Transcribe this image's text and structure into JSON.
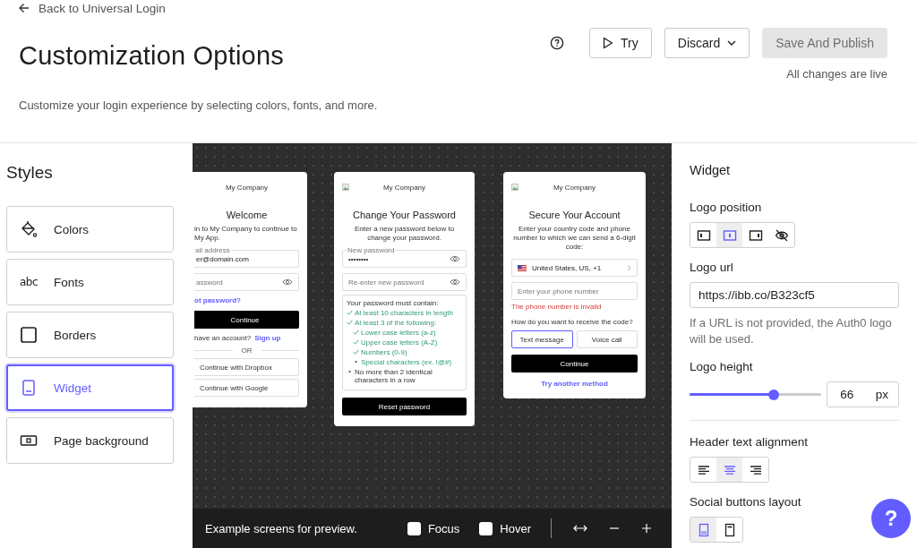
{
  "header": {
    "back_link": "Back to Universal Login",
    "title": "Customization Options",
    "subtitle": "Customize your login experience by selecting colors, fonts, and more.",
    "buttons": [
      {
        "label": "Try",
        "kind": "play",
        "disabled": false
      },
      {
        "label": "Discard",
        "kind": "dropdown",
        "disabled": false
      },
      {
        "label": "Save And Publish",
        "kind": "primary",
        "disabled": true
      }
    ],
    "status": "All changes are live"
  },
  "sidebar": {
    "title": "Styles",
    "items": [
      {
        "label": "Colors",
        "selected": false
      },
      {
        "label": "Fonts",
        "icon_text": "abc",
        "selected": false
      },
      {
        "label": "Borders",
        "selected": false
      },
      {
        "label": "Widget",
        "selected": true
      },
      {
        "label": "Page background",
        "selected": false
      }
    ]
  },
  "preview": {
    "cards": [
      {
        "elements": [
          {
            "kind": "logo",
            "text": "My Company",
            "image": false
          },
          {
            "kind": "title",
            "text": "Welcome"
          },
          {
            "kind": "text",
            "text": "in to My Company to continue to My App."
          },
          {
            "kind": "field",
            "label": "ail address",
            "value": "er@domain.com",
            "eye": false
          },
          {
            "kind": "field",
            "placeholder": "assword",
            "eye": true
          },
          {
            "kind": "forgot_link",
            "text": "ot password?"
          },
          {
            "kind": "button",
            "text": "Continue"
          },
          {
            "kind": "signup",
            "text": "have an account?",
            "link": "Sign up"
          },
          {
            "kind": "separator",
            "text": "OR"
          },
          {
            "kind": "social",
            "text": "Continue with Dropbox"
          },
          {
            "kind": "social",
            "text": "Continue with Google"
          }
        ]
      },
      {
        "elements": [
          {
            "kind": "logo",
            "text": "My Company",
            "image": true
          },
          {
            "kind": "title",
            "text": "Change Your Password"
          },
          {
            "kind": "text",
            "text": "Enter a new password below to change your password."
          },
          {
            "kind": "field",
            "label": "New password",
            "value": "••••••••",
            "eye": true
          },
          {
            "kind": "field",
            "placeholder": "Re-enter new password",
            "eye": true
          },
          {
            "kind": "checklist",
            "heading": "Your password must contain:",
            "items": [
              {
                "text": "At least 10 characters in length",
                "met": true
              },
              {
                "text": "At least 3 of the following:",
                "met": true,
                "children": [
                  {
                    "text": "Lower case letters (a-z)",
                    "met": true
                  },
                  {
                    "text": "Upper case letters (A-Z)",
                    "met": true
                  },
                  {
                    "text": "Numbers (0-9)",
                    "met": true
                  },
                  {
                    "text": "Special characters (ex. !@#)",
                    "met": false
                  }
                ]
              },
              {
                "text": "No more than 2 identical characters in a row",
                "met": false
              }
            ]
          },
          {
            "kind": "button",
            "text": "Reset password"
          }
        ]
      },
      {
        "elements": [
          {
            "kind": "logo",
            "text": "My Company",
            "image": true
          },
          {
            "kind": "title",
            "text": "Secure Your Account"
          },
          {
            "kind": "text",
            "text": "Enter your country code and phone number to which we can send a 6-digit code:"
          },
          {
            "kind": "select",
            "value": "United States, US, +1"
          },
          {
            "kind": "field",
            "placeholder": "Enter your phone number",
            "eye": false
          },
          {
            "kind": "error",
            "text": "The phone number is invalid"
          },
          {
            "kind": "prompt",
            "text": "How do you want to receive the code?"
          },
          {
            "kind": "choices",
            "options": [
              {
                "label": "Text message",
                "selected": true
              },
              {
                "label": "Voice call",
                "selected": false
              }
            ]
          },
          {
            "kind": "button",
            "text": "Continue"
          },
          {
            "kind": "link",
            "text": "Try another method"
          }
        ]
      }
    ],
    "caption": "Example screens for preview.",
    "toggles": [
      {
        "label": "Focus",
        "checked": false
      },
      {
        "label": "Hover",
        "checked": false
      }
    ]
  },
  "panel": {
    "title": "Widget",
    "logo_position": {
      "label": "Logo position",
      "options": [
        {
          "selected": false
        },
        {
          "selected": true
        },
        {
          "selected": false
        },
        {
          "selected": false
        }
      ]
    },
    "logo_url": {
      "label": "Logo url",
      "value": "https://ibb.co/B323cf5",
      "hint": "If a URL is not provided, the Auth0 logo will be used."
    },
    "logo_height": {
      "label": "Logo height",
      "level": 0.64,
      "value": "66",
      "unit": "px"
    },
    "header_alignment": {
      "label": "Header text alignment",
      "options": [
        {
          "selected": false
        },
        {
          "selected": true
        },
        {
          "selected": false
        }
      ]
    },
    "social_layout": {
      "label": "Social buttons layout",
      "options": [
        {
          "selected": true
        },
        {
          "selected": false
        }
      ]
    }
  },
  "help_bubble": "?"
}
